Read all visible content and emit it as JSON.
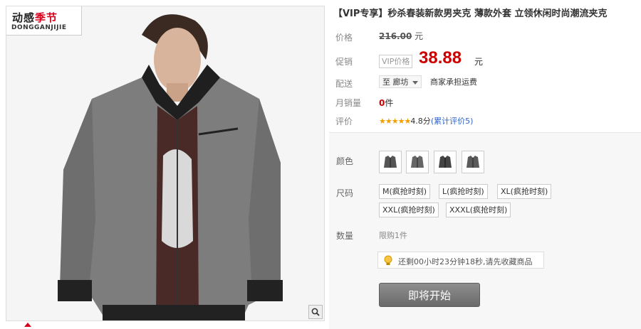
{
  "brand": {
    "main_black": "动感",
    "main_red": "季节",
    "sub": "DONGGANJIJIE"
  },
  "product": {
    "title": "【VIP专享】秒杀春装新款男夹克 薄款外套 立领休闲时尚潮流夹克"
  },
  "price": {
    "label": "价格",
    "original": "216.00",
    "original_unit": "元",
    "promo_label": "促销",
    "vip_tag": "VIP价格",
    "promo": "38.88",
    "promo_unit": "元"
  },
  "shipping": {
    "label": "配送",
    "city": "至 廊坊",
    "note": "商家承担运费"
  },
  "sales": {
    "label": "月销量",
    "count": "0",
    "unit": "件"
  },
  "rating": {
    "label": "评价",
    "stars": "★★★★★",
    "score": "4.8分",
    "link": "(累计评价5)"
  },
  "options": {
    "color_label": "颜色",
    "colors": [
      "gray-jacket-1",
      "gray-jacket-2",
      "gray-jacket-3",
      "gray-jacket-4"
    ],
    "size_label": "尺码",
    "sizes": [
      "M(疯抢时刻)",
      "L(疯抢时刻)",
      "XL(疯抢时刻)",
      "XXL(疯抢时刻)",
      "XXXL(疯抢时刻)"
    ],
    "qty_label": "数量",
    "limit": "限购1件",
    "notice": "还剩00小时23分钟18秒,请先收藏商品",
    "buy_button": "即将开始"
  },
  "colors": {
    "price_red": "#cc0000",
    "brand_red": "#d6001c",
    "button_gray": "#7a7a7a",
    "link_blue": "#3366cc"
  },
  "icons": {
    "zoom": "magnifier-icon",
    "notice": "lightbulb-icon",
    "dropdown": "chevron-down-icon"
  }
}
